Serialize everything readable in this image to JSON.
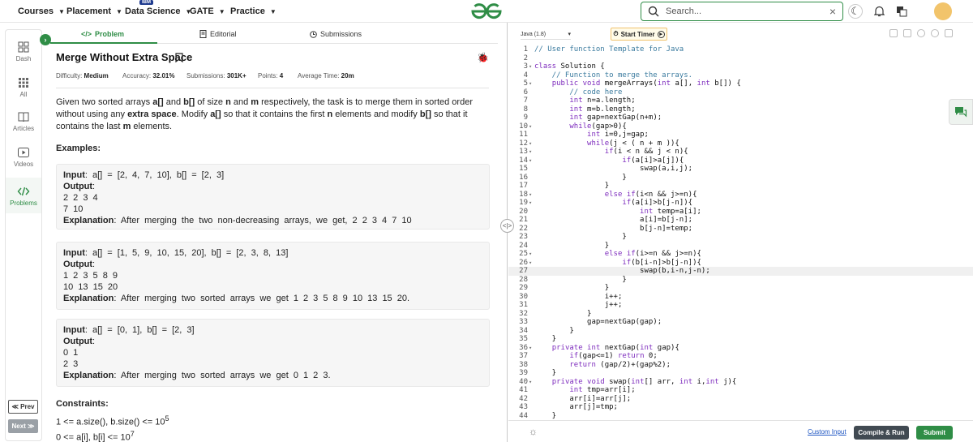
{
  "nav": {
    "items": [
      "Courses",
      "Placement",
      "Data Science",
      "GATE",
      "Practice"
    ],
    "ibm_badge": "IBM",
    "search_placeholder": "Search...",
    "search_clear": "×"
  },
  "rail": {
    "items": [
      "Dash",
      "All",
      "Articles",
      "Videos",
      "Problems"
    ],
    "prev": "≪ Prev",
    "next": "Next ≫",
    "expand": "›"
  },
  "tabs": {
    "problem": "Problem",
    "editorial": "Editorial",
    "submissions": "Submissions"
  },
  "problem": {
    "title": "Merge Without Extra Space",
    "difficulty_label": "Difficulty:",
    "difficulty": "Medium",
    "accuracy_label": "Accuracy:",
    "accuracy": "32.01%",
    "submissions_label": "Submissions:",
    "submissions": "301K+",
    "points_label": "Points:",
    "points": "4",
    "avgtime_label": "Average Time:",
    "avgtime": "20m",
    "desc": {
      "p1": "Given two sorted arrays ",
      "a": "a[]",
      "p2": " and ",
      "b": "b[]",
      "p3": " of size ",
      "n": "n",
      "p4": " and ",
      "m": "m",
      "p5": " respectively, the task is to merge them in sorted order without using any ",
      "extra": "extra space",
      "p6": ". Modify ",
      "a2": "a[]",
      "p7": " so that it contains the first ",
      "n2": "n",
      "p8": " elements and modify ",
      "b2": "b[]",
      "p9": " so that it contains the last ",
      "m2": "m",
      "p10": " elements."
    },
    "examples_heading": "Examples:",
    "input_label": "Input",
    "output_label": "Output",
    "explanation_label": "Explanation",
    "examples": [
      {
        "input": ": a[] = [2, 4, 7, 10], b[] = [2, 3]",
        "out1": "2 2 3 4",
        "out2": "7 10",
        "explanation": ": After merging the two non-decreasing arrays, we get, 2 2 3 4 7 10"
      },
      {
        "input": ": a[] = [1, 5, 9, 10, 15, 20], b[] = [2, 3, 8, 13]",
        "out1": "1 2 3 5 8 9",
        "out2": "10 13 15 20",
        "explanation": ": After merging two sorted arrays we get 1 2 3 5 8 9 10 13 15 20."
      },
      {
        "input": ": a[] = [0, 1], b[] = [2, 3]",
        "out1": "0 1",
        "out2": "2 3",
        "explanation": ": After merging two sorted arrays we get 0 1 2 3."
      }
    ],
    "constraints_heading": "Constraints:",
    "c1": "1 <= a.size(), b.size() <= 10",
    "c1_exp": "5",
    "c2": "0 <= a[i], b[i] <= 10",
    "c2_exp": "7"
  },
  "editor": {
    "language": "Java (1.8)",
    "timer": "Start Timer",
    "lines": [
      "// User function Template for Java",
      "",
      "class Solution {",
      "    // Function to merge the arrays.",
      "    public void mergeArrays(int a[], int b[]) {",
      "        // code here",
      "        int n=a.length;",
      "        int m=b.length;",
      "        int gap=nextGap(n+m);",
      "        while(gap>0){",
      "            int i=0,j=gap;",
      "            while(j < ( n + m )){",
      "                if(i < n && j < n){",
      "                    if(a[i]>a[j]){",
      "                        swap(a,i,j);",
      "                    }",
      "                }",
      "                else if(i<n && j>=n){",
      "                    if(a[i]>b[j-n]){",
      "                        int temp=a[i];",
      "                        a[i]=b[j-n];",
      "                        b[j-n]=temp;",
      "                    }",
      "                }",
      "                else if(i>=n && j>=n){",
      "                    if(b[i-n]>b[j-n]){",
      "                        swap(b,i-n,j-n);",
      "                    }",
      "                }",
      "                i++;",
      "                j++;",
      "            }",
      "            gap=nextGap(gap);",
      "        }",
      "    }",
      "    private int nextGap(int gap){",
      "        if(gap<=1) return 0;",
      "        return (gap/2)+(gap%2);",
      "    }",
      "    private void swap(int[] arr, int i,int j){",
      "        int tmp=arr[i];",
      "        arr[i]=arr[j];",
      "        arr[j]=tmp;",
      "    }"
    ],
    "custom_input": "Custom Input",
    "compile_run": "Compile & Run",
    "submit": "Submit"
  }
}
